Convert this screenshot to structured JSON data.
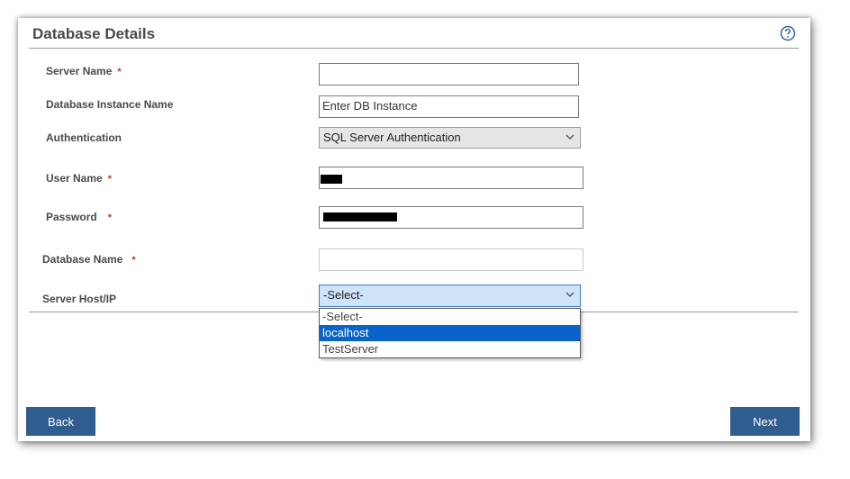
{
  "header": {
    "title": "Database Details",
    "help_icon": "question-circle-icon"
  },
  "form": {
    "server_name": {
      "label": "Server Name",
      "required_mark": "*",
      "value": ""
    },
    "instance_name": {
      "label": "Database Instance Name",
      "placeholder": "Enter DB Instance",
      "value": ""
    },
    "authentication": {
      "label": "Authentication",
      "selected": "SQL Server Authentication"
    },
    "user_name": {
      "label": "User Name",
      "required_mark": "*"
    },
    "password": {
      "label": "Password",
      "required_mark": "*"
    },
    "database_name": {
      "label": "Database Name",
      "required_mark": "*",
      "value": ""
    },
    "server_host": {
      "label": "Server Host/IP",
      "selected": "-Select-",
      "options": [
        "-Select-",
        "localhost",
        "TestServer"
      ],
      "highlighted_option": "localhost"
    }
  },
  "footer": {
    "back_label": "Back",
    "next_label": "Next"
  },
  "colors": {
    "button": "#2e5d8e",
    "required": "#c0392b",
    "highlight": "#0a63c9"
  }
}
